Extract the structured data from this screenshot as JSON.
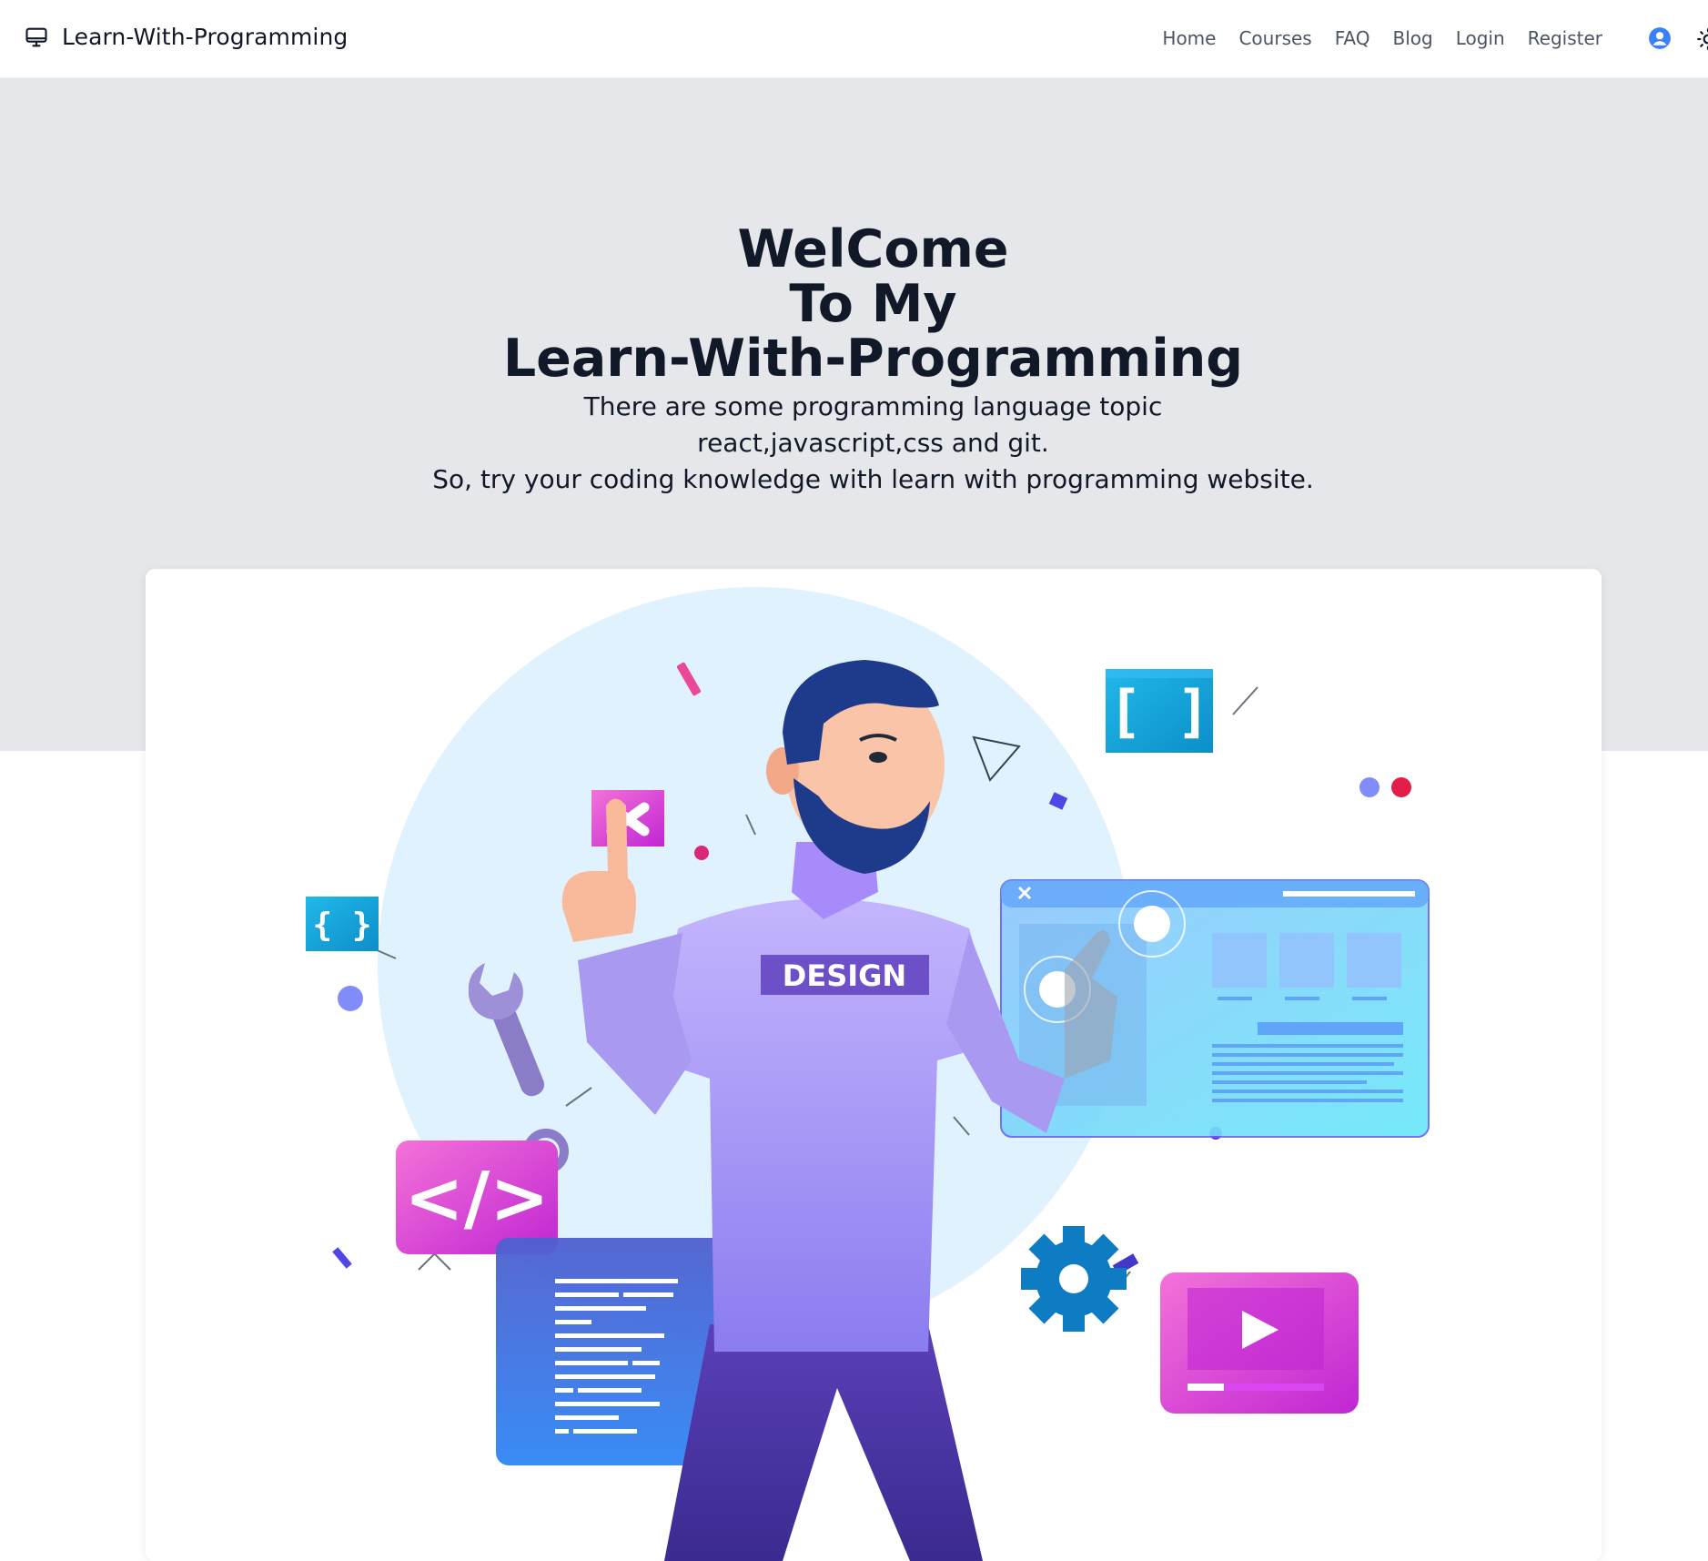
{
  "navbar": {
    "brand_name": "Learn-With-Programming",
    "brand_icon": "monitor-icon",
    "links": [
      {
        "label": "Home"
      },
      {
        "label": "Courses"
      },
      {
        "label": "FAQ"
      },
      {
        "label": "Blog"
      },
      {
        "label": "Login"
      },
      {
        "label": "Register"
      }
    ],
    "user_icon": "user-circle-icon",
    "theme_icon": "sun-icon"
  },
  "hero": {
    "title_lines": [
      "WelCome",
      "To My",
      "Learn-With-Programming"
    ],
    "description_lines": [
      "There are some programming language topic",
      "react,javascript,css and git.",
      "So, try your coding knowledge with learn with programming website."
    ]
  },
  "illustration": {
    "shirt_text": "DESIGN",
    "brace_badge_text": "{ }",
    "bracket_badge_text": "[ ]",
    "code_badge_text": "</>"
  },
  "colors": {
    "hero_bg": "#e5e7eb",
    "text": "#111827",
    "nav_link": "#4b5563",
    "accent_blue": "#3b82f6"
  }
}
